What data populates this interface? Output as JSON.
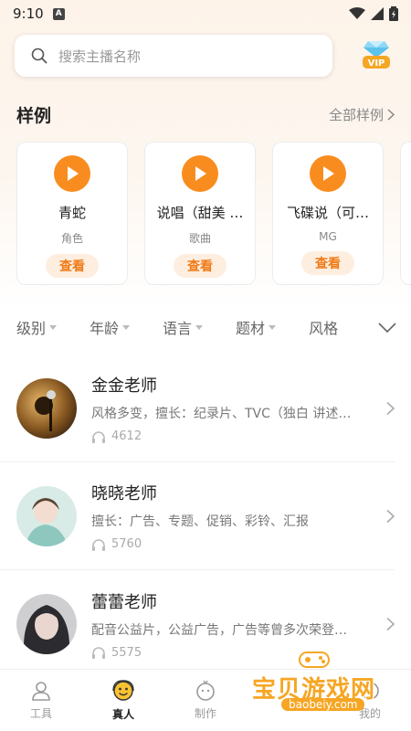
{
  "status_bar": {
    "time": "9:10",
    "notification_icon": "a-icon"
  },
  "search": {
    "placeholder": "搜索主播名称"
  },
  "vip": {
    "label": "VIP"
  },
  "samples_section": {
    "title": "样例",
    "more_label": "全部样例",
    "items": [
      {
        "name": "青蛇",
        "tag": "角色",
        "action": "查看"
      },
      {
        "name": "说唱（甜美 …",
        "tag": "歌曲",
        "action": "查看"
      },
      {
        "name": "飞碟说（可…",
        "tag": "MG",
        "action": "查看"
      }
    ]
  },
  "filters": [
    "级别",
    "年龄",
    "语言",
    "题材",
    "风格"
  ],
  "teachers": [
    {
      "name": "金金老师",
      "desc": "风格多变，擅长：纪录片、TVC（独白 讲述…",
      "plays": "4612"
    },
    {
      "name": "晓晓老师",
      "desc": "擅长：广告、专题、促销、彩铃、汇报",
      "plays": "5760"
    },
    {
      "name": "蕾蕾老师",
      "desc": "配音公益片，公益广告，广告等曾多次荣登…",
      "plays": "5575"
    }
  ],
  "tabbar": [
    {
      "label": "工具",
      "icon": "person-outline-icon",
      "active": false
    },
    {
      "label": "真人",
      "icon": "smiley-headset-icon",
      "active": true
    },
    {
      "label": "制作",
      "icon": "face-outline-icon",
      "active": false
    },
    {
      "label": "",
      "icon": "hidden-icon",
      "active": false
    },
    {
      "label": "我的",
      "icon": "profile-icon",
      "active": false
    }
  ],
  "watermark": {
    "text": "宝贝游戏网",
    "url": "baobeiy.com"
  },
  "colors": {
    "accent": "#f98c1f",
    "accent_text": "#f07a16",
    "accent_bg": "#fdeee0"
  }
}
